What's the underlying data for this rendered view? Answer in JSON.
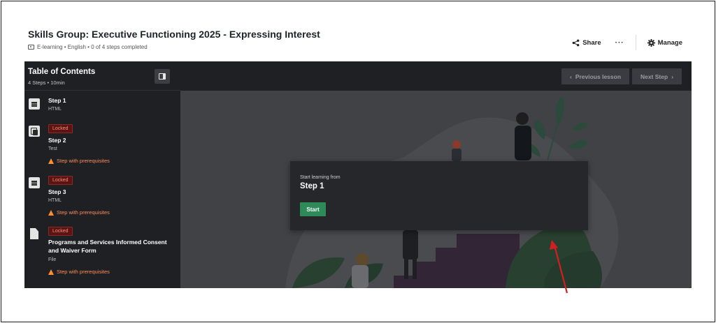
{
  "header": {
    "title": "Skills Group: Executive Functioning 2025 - Expressing Interest",
    "meta": "E-learning • English • 0 of 4 steps completed",
    "share_label": "Share",
    "more_label": "···",
    "manage_label": "Manage"
  },
  "sidebar": {
    "title": "Table of Contents",
    "subtitle": "4 Steps •  10min",
    "steps": [
      {
        "name": "Step 1",
        "type": "HTML",
        "badge": "",
        "prereq": "",
        "icon": "document-icon"
      },
      {
        "name": "Step 2",
        "type": "Test",
        "badge": "Locked",
        "prereq": "Step with prerequisites",
        "icon": "test-icon"
      },
      {
        "name": "Step 3",
        "type": "HTML",
        "badge": "Locked",
        "prereq": "Step with prerequisites",
        "icon": "document-icon"
      },
      {
        "name": "Programs and Services Informed Consent and Waiver Form",
        "type": "File",
        "badge": "Locked",
        "prereq": "Step with prerequisites",
        "icon": "file-icon"
      }
    ]
  },
  "nav": {
    "prev_label": "Previous lesson",
    "next_label": "Next Step",
    "prev_chevron": "‹",
    "next_chevron": "›"
  },
  "modal": {
    "subtitle": "Start learning from",
    "title": "Step 1",
    "start_label": "Start"
  },
  "colors": {
    "accent": "#2e8b57",
    "locked": "#ff8a7e",
    "warning": "#ff8c2e"
  }
}
